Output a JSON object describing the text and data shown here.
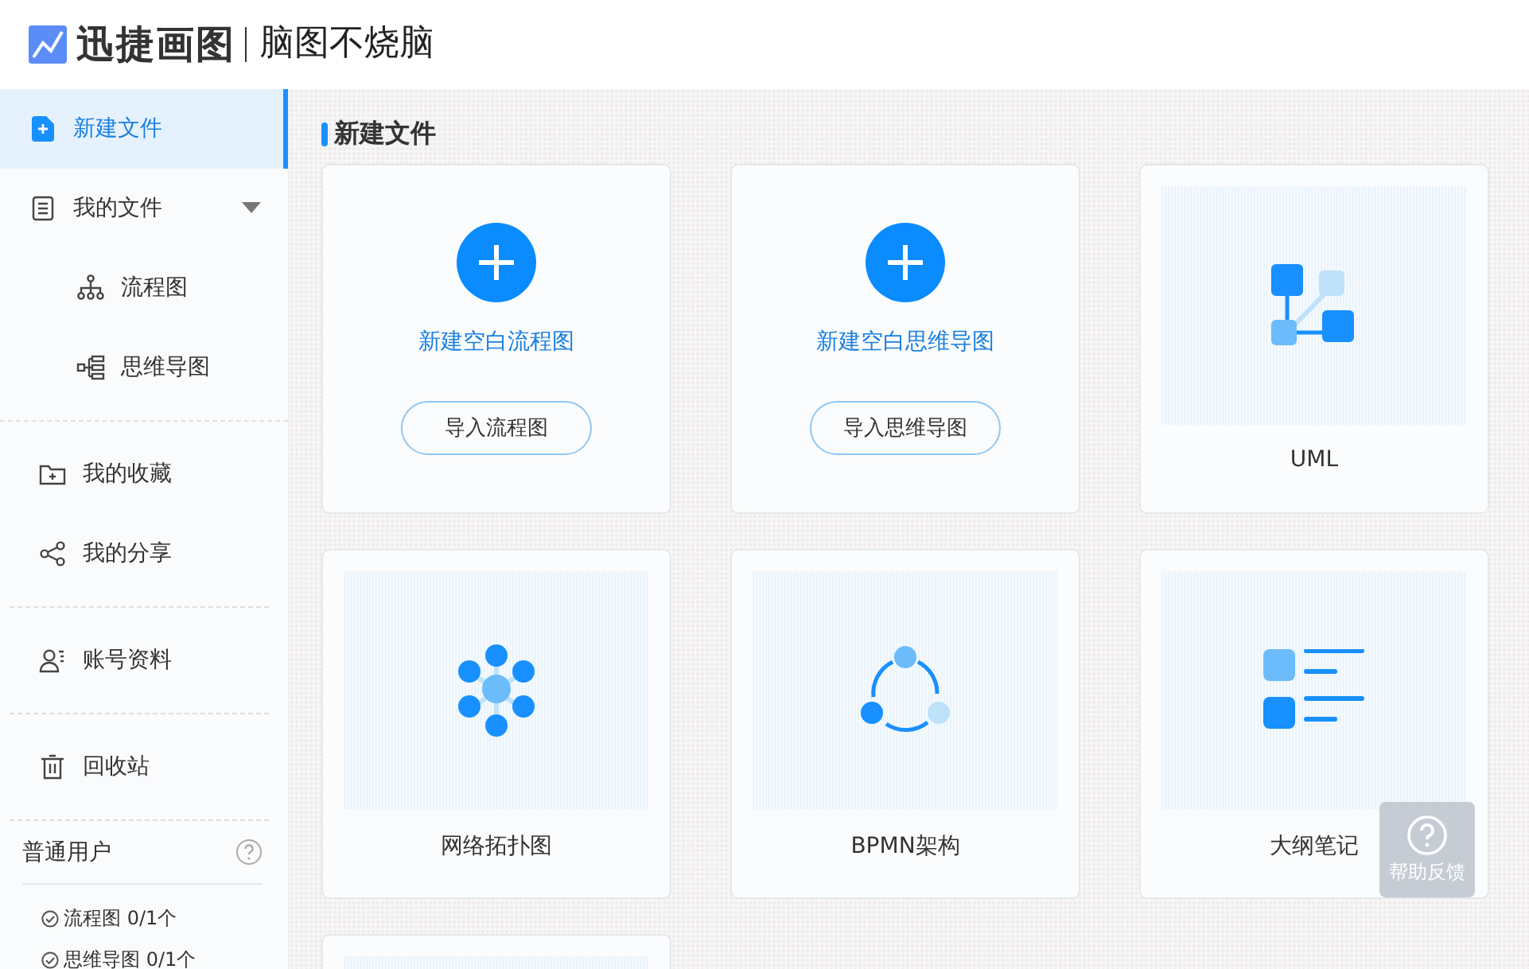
{
  "header": {
    "brand": "迅捷画图",
    "slogan": "脑图不烧脑"
  },
  "sidebar": {
    "groups": [
      {
        "items": [
          {
            "label": "新建文件",
            "selected": true
          },
          {
            "label": "我的文件",
            "selected": false,
            "expanded": true,
            "children": [
              {
                "label": "流程图",
                "selected": false
              },
              {
                "label": "思维导图",
                "selected": false
              }
            ]
          }
        ]
      },
      {
        "items": [
          {
            "label": "我的收藏",
            "selected": false
          },
          {
            "label": "我的分享",
            "selected": false
          }
        ]
      },
      {
        "items": [
          {
            "label": "账号资料",
            "selected": false
          }
        ]
      },
      {
        "items": [
          {
            "label": "回收站",
            "selected": false
          }
        ]
      }
    ],
    "account": {
      "title": "普通用户",
      "quotas": [
        "流程图 0/1个",
        "思维导图 0/1个"
      ]
    }
  },
  "main": {
    "title": "新建文件",
    "cards": [
      {
        "kind": "blank",
        "title": "新建空白流程图",
        "button": "导入流程图"
      },
      {
        "kind": "blank",
        "title": "新建空白思维导图",
        "button": "导入思维导图"
      },
      {
        "kind": "template",
        "label": "UML"
      },
      {
        "kind": "template",
        "label": "网络拓扑图"
      },
      {
        "kind": "template",
        "label": "BPMN架构"
      },
      {
        "kind": "template",
        "label": "大纲笔记"
      },
      {
        "kind": "template"
      }
    ]
  },
  "help": {
    "label": "帮助反馈"
  }
}
